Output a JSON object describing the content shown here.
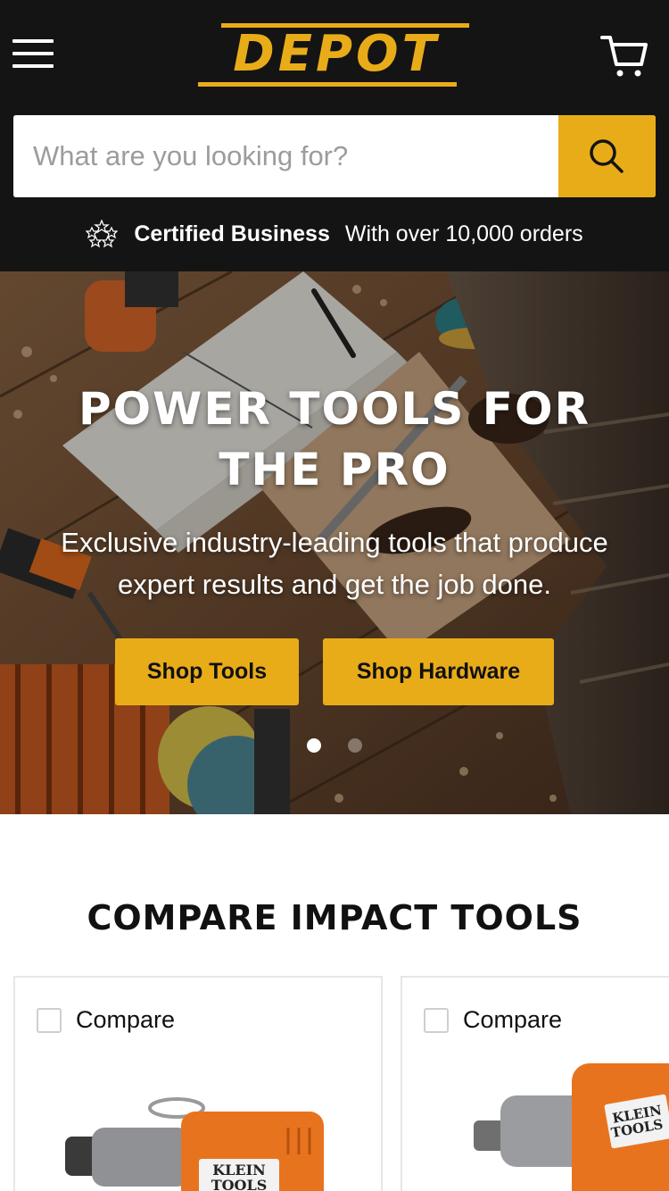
{
  "header": {
    "logo_text": "DEPOT",
    "search": {
      "placeholder": "What are you looking for?"
    },
    "certified": {
      "strong": "Certified Business",
      "text": "With over 10,000 orders"
    }
  },
  "hero": {
    "title_line1": "POWER TOOLS FOR",
    "title_line2": "THE PRO",
    "subtitle_line1": "Exclusive industry-leading tools that produce",
    "subtitle_line2": "expert results and get the job done.",
    "buttons": {
      "tools": "Shop Tools",
      "hardware": "Shop Hardware"
    },
    "slides": {
      "count": 2,
      "active": 1
    }
  },
  "compare": {
    "title": "COMPARE IMPACT TOOLS",
    "cards": [
      {
        "label": "Compare",
        "brand_line1": "KLEIN",
        "brand_line2": "TOOLS"
      },
      {
        "label": "Compare",
        "brand_line1": "KLEIN",
        "brand_line2": "TOOLS"
      }
    ]
  },
  "colors": {
    "accent": "#e9ac19",
    "header_bg": "#141414",
    "text": "#111111"
  },
  "icons": [
    "menu-icon",
    "cart-icon",
    "search-icon",
    "stars-badge-icon"
  ]
}
